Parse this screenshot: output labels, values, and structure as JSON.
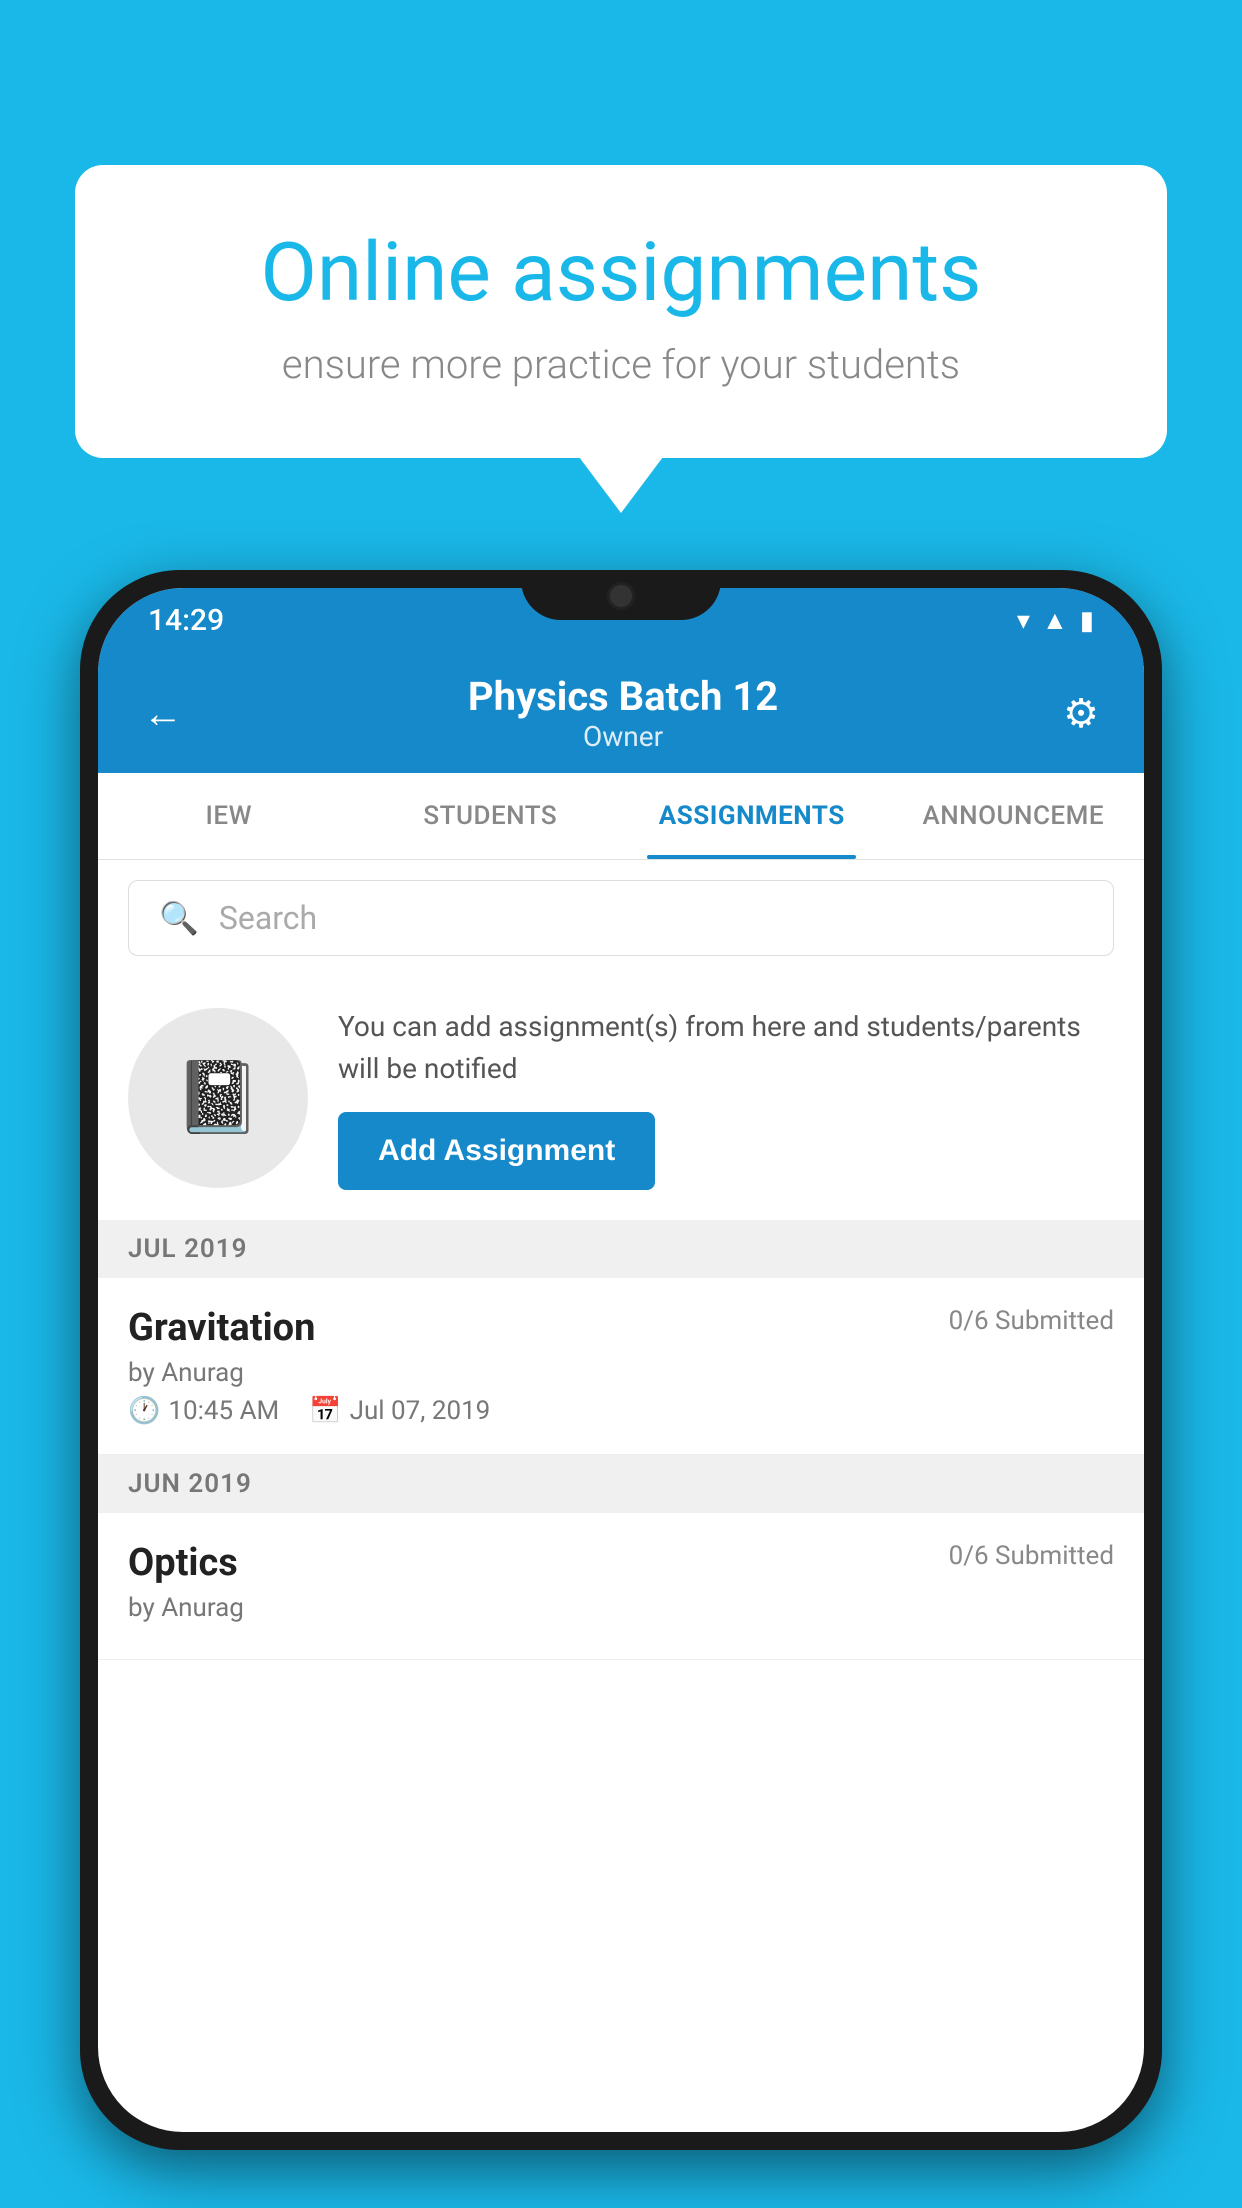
{
  "background": {
    "color": "#1ab8e8"
  },
  "speech_bubble": {
    "title": "Online assignments",
    "subtitle": "ensure more practice for your students"
  },
  "status_bar": {
    "time": "14:29",
    "icons": [
      "wifi",
      "signal",
      "battery"
    ]
  },
  "app_header": {
    "title": "Physics Batch 12",
    "subtitle": "Owner",
    "back_label": "←",
    "settings_label": "⚙"
  },
  "tabs": [
    {
      "label": "IEW",
      "active": false
    },
    {
      "label": "STUDENTS",
      "active": false
    },
    {
      "label": "ASSIGNMENTS",
      "active": true
    },
    {
      "label": "ANNOUNCEME",
      "active": false
    }
  ],
  "search": {
    "placeholder": "Search"
  },
  "promo": {
    "text": "You can add assignment(s) from here and students/parents will be notified",
    "button_label": "Add Assignment"
  },
  "sections": [
    {
      "month": "JUL 2019",
      "assignments": [
        {
          "name": "Gravitation",
          "submitted": "0/6 Submitted",
          "by": "by Anurag",
          "time": "10:45 AM",
          "date": "Jul 07, 2019"
        }
      ]
    },
    {
      "month": "JUN 2019",
      "assignments": [
        {
          "name": "Optics",
          "submitted": "0/6 Submitted",
          "by": "by Anurag",
          "time": "",
          "date": ""
        }
      ]
    }
  ]
}
